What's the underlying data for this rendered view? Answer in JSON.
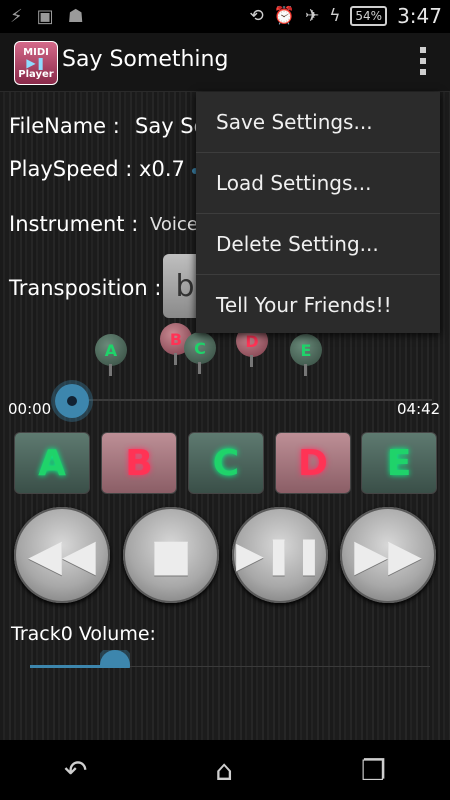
{
  "status": {
    "battery": "54%",
    "time": "3:47"
  },
  "app": {
    "icon_top": "MIDI",
    "icon_bottom": "Player",
    "title": "Say Something"
  },
  "file": {
    "label": "FileName :",
    "value": "Say So"
  },
  "speed": {
    "label": "PlaySpeed : x0.7"
  },
  "instrument": {
    "label": "Instrument :",
    "value": "Voice"
  },
  "transposition": {
    "label": "Transposition :",
    "button": "b"
  },
  "markers": [
    {
      "letter": "A",
      "color": "green"
    },
    {
      "letter": "B",
      "color": "red"
    },
    {
      "letter": "C",
      "color": "green"
    },
    {
      "letter": "D",
      "color": "red"
    },
    {
      "letter": "E",
      "color": "green"
    }
  ],
  "seek": {
    "current": "00:00",
    "total": "04:42"
  },
  "ab_buttons": [
    "A",
    "B",
    "C",
    "D",
    "E"
  ],
  "controls": {
    "rewind": "◀◀",
    "stop": "■",
    "play_pause": "▶❚❚",
    "forward": "▶▶"
  },
  "volume": {
    "label": "Track0 Volume:",
    "level_fraction": 0.22
  },
  "menu": {
    "items": [
      "Save Settings...",
      "Load Settings...",
      "Delete Setting...",
      "Tell Your Friends!!"
    ]
  },
  "nav": {
    "back": "↶",
    "home": "⌂",
    "recents": "❐"
  },
  "colors": {
    "accent": "#3d86ad",
    "green_text": "#1fd36a",
    "red_text": "#ff3355"
  }
}
